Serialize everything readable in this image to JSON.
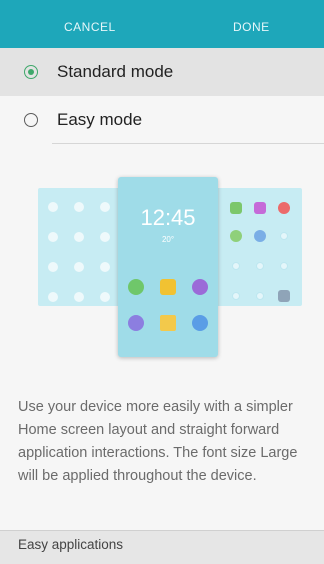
{
  "actionbar": {
    "cancel_label": "CANCEL",
    "done_label": "DONE"
  },
  "modes": [
    {
      "label": "Standard mode",
      "checked": true
    },
    {
      "label": "Easy mode",
      "checked": false
    }
  ],
  "preview": {
    "time": "12:45",
    "temperature": "20°"
  },
  "description": "Use your device more easily with a simpler Home screen layout and straight forward application interactions. The font size Large will be applied throughout the device.",
  "section": {
    "title": "Easy applications"
  },
  "colors": {
    "accent": "#1ea7ba",
    "radio_checked": "#3fa86b"
  }
}
